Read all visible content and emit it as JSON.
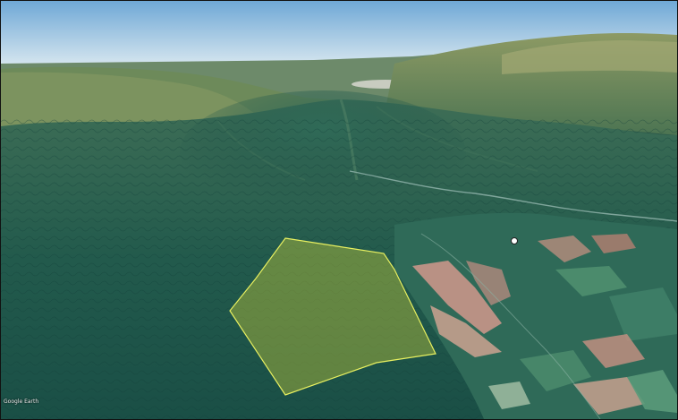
{
  "map": {
    "view": "3d-satellite-oblique",
    "attribution": "Google Earth",
    "place_label": "",
    "colors": {
      "sky_top": "#6fa8d6",
      "sky_horizon": "#d6e6ef",
      "forest": "#1f5a4d",
      "highland": "#8a9a62",
      "farmland_pink": "#c9968a",
      "farmland_green": "#4f8f6f",
      "boundary_stroke": "#e8f060",
      "boundary_fill": "#b8c23a"
    }
  }
}
